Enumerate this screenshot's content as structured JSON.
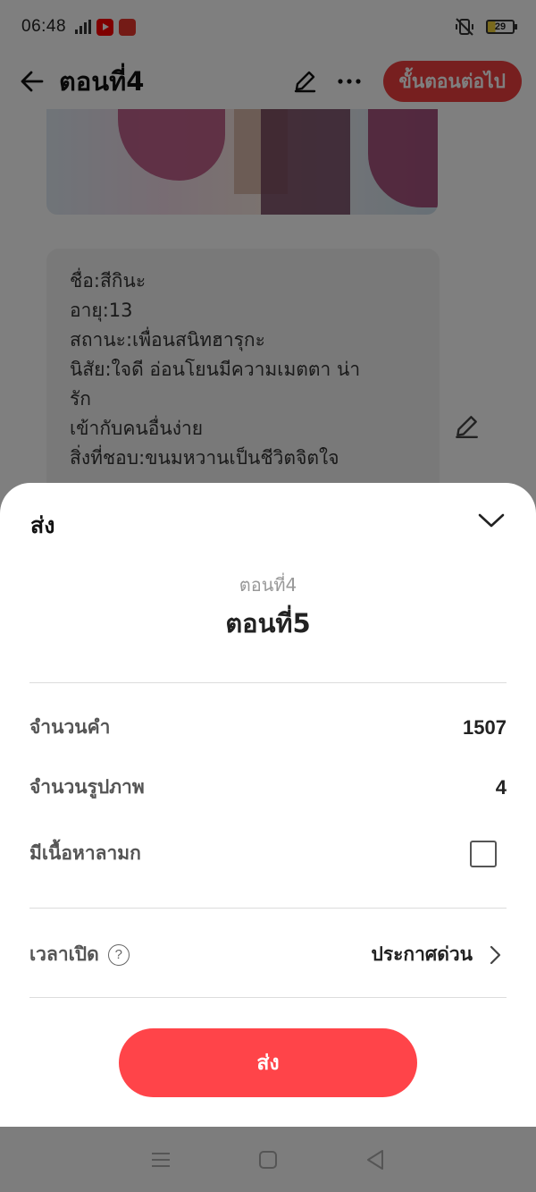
{
  "status_bar": {
    "time": "06:48",
    "network": "4G",
    "battery": "29",
    "icons": [
      "signal-icon",
      "youtube-app-icon",
      "manga-toon-app-icon",
      "vibrate-mute-icon",
      "battery-icon"
    ]
  },
  "app_bar": {
    "title": "ตอนที่4",
    "next_step_label": "ขั้นตอนต่อไป",
    "icons": [
      "back-arrow-icon",
      "edit-pencil-icon",
      "more-dots-icon"
    ]
  },
  "background_card": {
    "lines": [
      "ชื่อ:สีกินะ",
      "อายุ:13",
      "สถานะ:เพื่อนสนิทฮารุกะ",
      "นิสัย:ใจดี อ่อนโยนมีความเมตตา น่ารัก",
      "เข้ากับคนอื่นง่าย",
      "สิ่งที่ชอบ:ขนมหวานเป็นชีวิตจิตใจ ฮารุ",
      "กะ"
    ]
  },
  "sheet": {
    "title": "ส่ง",
    "from_chapter": "ตอนที่4",
    "to_chapter": "ตอนที่5",
    "word_count_label": "จำนวนคำ",
    "word_count_value": "1507",
    "image_count_label": "จำนวนรูปภาพ",
    "image_count_value": "4",
    "explicit_label": "มีเนื้อหาลามก",
    "explicit_checked": false,
    "publish_time_label": "เวลาเปิด",
    "publish_time_help": "?",
    "publish_time_value": "ประกาศด่วน",
    "submit_label": "ส่ง"
  },
  "colors": {
    "accent": "#ff4449",
    "overlay": "rgba(0,0,0,0.5)",
    "nav_bar": "#7d7d7d"
  }
}
